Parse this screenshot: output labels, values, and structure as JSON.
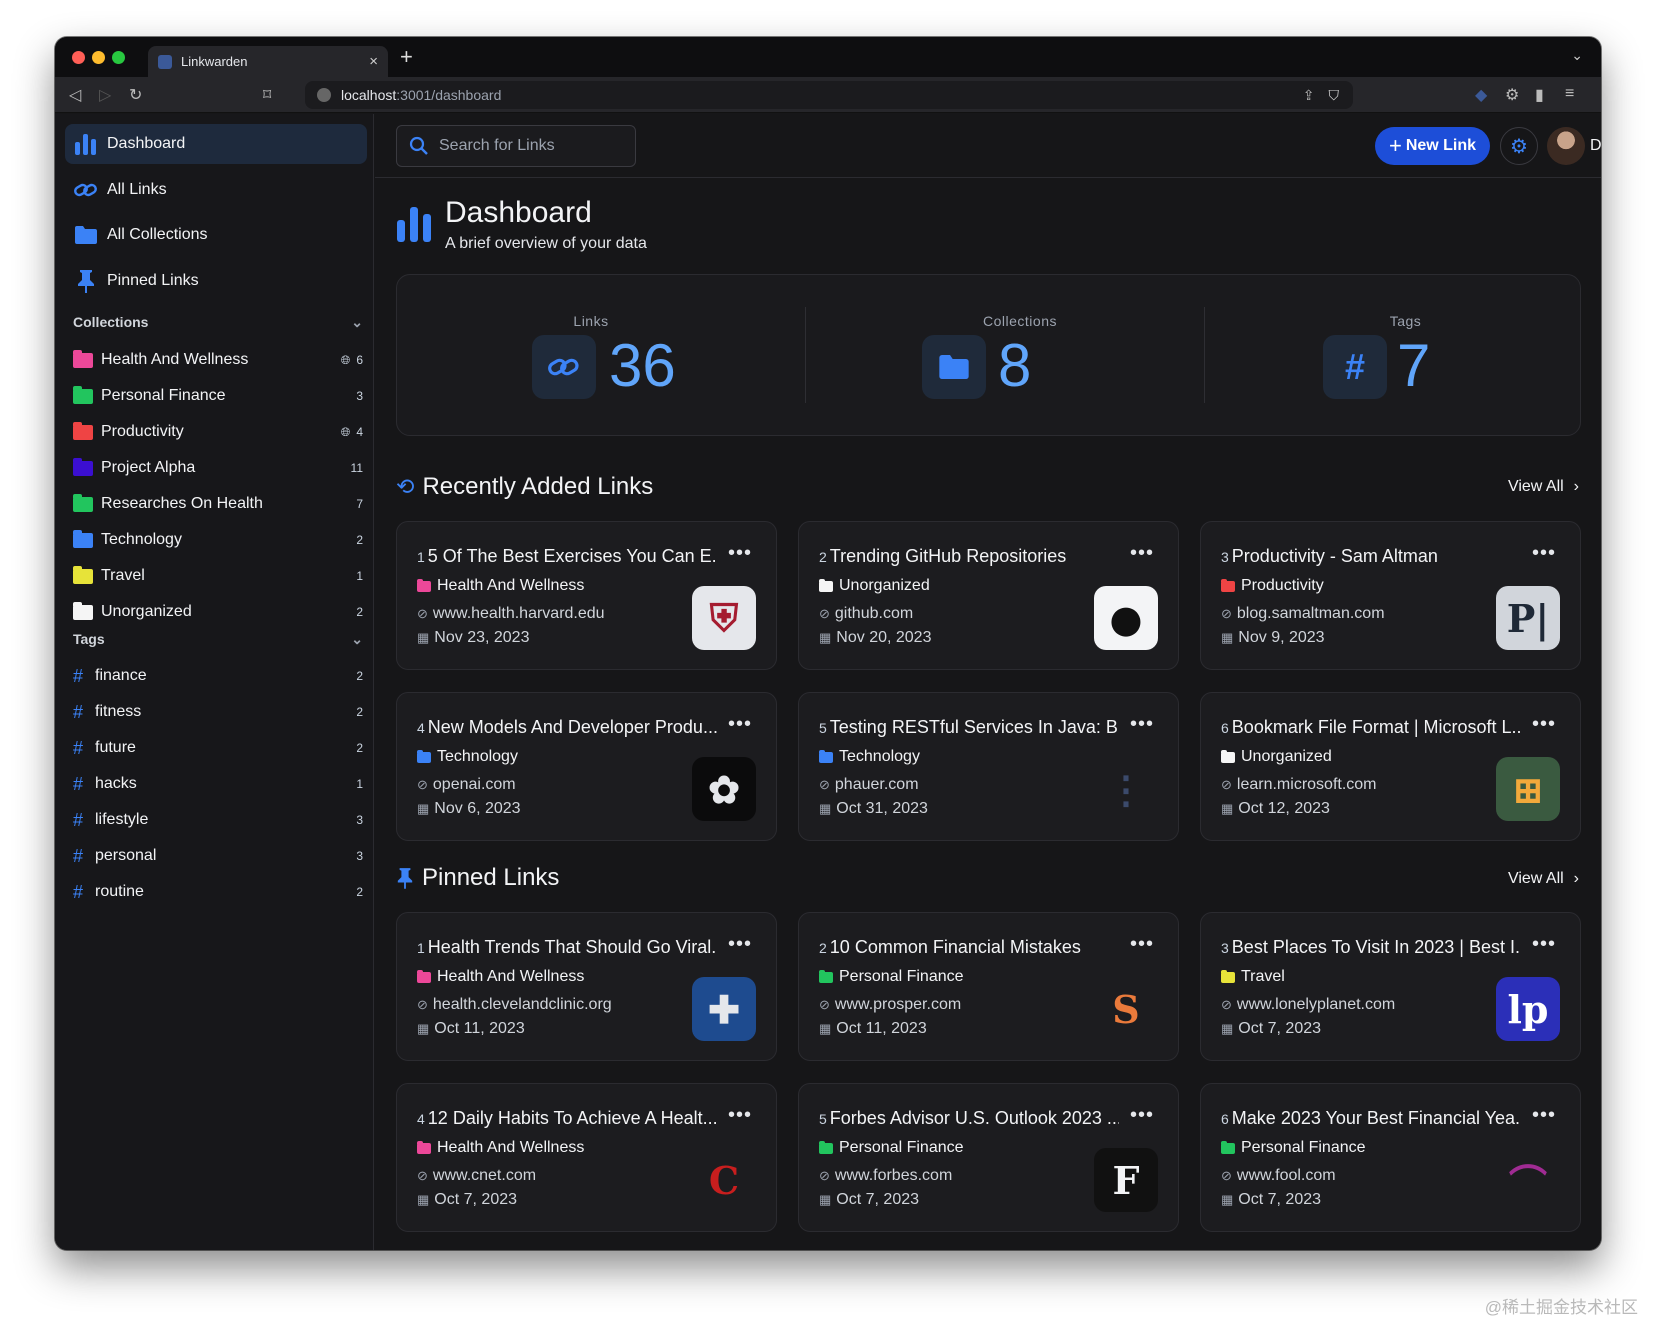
{
  "browser": {
    "tab_title": "Linkwarden",
    "tab_close": "×",
    "new_tab": "+",
    "url_host": "localhost",
    "url_path": ":3001/dashboard"
  },
  "sidebar": {
    "nav": [
      {
        "label": "Dashboard",
        "icon": "chart-bar-icon"
      },
      {
        "label": "All Links",
        "icon": "link-icon"
      },
      {
        "label": "All Collections",
        "icon": "folder-icon"
      },
      {
        "label": "Pinned Links",
        "icon": "thumbtack-icon"
      }
    ],
    "collections_title": "Collections",
    "collections": [
      {
        "name": "Health And Wellness",
        "count": "6",
        "public": true,
        "color": "#ec4899"
      },
      {
        "name": "Personal Finance",
        "count": "3",
        "public": false,
        "color": "#22c55e"
      },
      {
        "name": "Productivity",
        "count": "4",
        "public": true,
        "color": "#ef4444"
      },
      {
        "name": "Project Alpha",
        "count": "11",
        "public": false,
        "color": "#3b0fd1"
      },
      {
        "name": "Researches On Health",
        "count": "7",
        "public": false,
        "color": "#22c55e"
      },
      {
        "name": "Technology",
        "count": "2",
        "public": false,
        "color": "#3b82f6"
      },
      {
        "name": "Travel",
        "count": "1",
        "public": false,
        "color": "#e7e339"
      },
      {
        "name": "Unorganized",
        "count": "2",
        "public": false,
        "color": "#f5f5f5"
      }
    ],
    "tags_title": "Tags",
    "tags": [
      {
        "name": "finance",
        "count": "2"
      },
      {
        "name": "fitness",
        "count": "2"
      },
      {
        "name": "future",
        "count": "2"
      },
      {
        "name": "hacks",
        "count": "1"
      },
      {
        "name": "lifestyle",
        "count": "3"
      },
      {
        "name": "personal",
        "count": "3"
      },
      {
        "name": "routine",
        "count": "2"
      }
    ]
  },
  "topbar": {
    "search_placeholder": "Search for Links",
    "new_link": "New Link",
    "user_name": "Daniel"
  },
  "header": {
    "title": "Dashboard",
    "subtitle": "A brief overview of your data"
  },
  "stats": [
    {
      "label": "Links",
      "value": "36"
    },
    {
      "label": "Collections",
      "value": "8"
    },
    {
      "label": "Tags",
      "value": "7"
    }
  ],
  "recent": {
    "title": "Recently Added Links",
    "view_all": "View All",
    "cards": [
      {
        "num": "1",
        "title": "5 Of The Best Exercises You Can E...",
        "collection": "Health And Wellness",
        "color": "#ec4899",
        "domain": "www.health.harvard.edu",
        "date": "Nov 23, 2023",
        "thumb_bg": "#e5e7eb",
        "thumb_fg": "#a51c30",
        "thumb_text": "⛨"
      },
      {
        "num": "2",
        "title": "Trending GitHub Repositories",
        "collection": "Unorganized",
        "color": "#f5f5f5",
        "domain": "github.com",
        "date": "Nov 20, 2023",
        "thumb_bg": "#f3f4f6",
        "thumb_fg": "#111",
        "thumb_text": "●"
      },
      {
        "num": "3",
        "title": "Productivity - Sam Altman",
        "collection": "Productivity",
        "color": "#ef4444",
        "domain": "blog.samaltman.com",
        "date": "Nov 9, 2023",
        "thumb_bg": "#d1d5db",
        "thumb_fg": "#1f2937",
        "thumb_text": "P|"
      },
      {
        "num": "4",
        "title": "New Models And Developer Produ...",
        "collection": "Technology",
        "color": "#3b82f6",
        "domain": "openai.com",
        "date": "Nov 6, 2023",
        "thumb_bg": "#0b0b0c",
        "thumb_fg": "#e5e7eb",
        "thumb_text": "✿"
      },
      {
        "num": "5",
        "title": "Testing RESTful Services In Java: B...",
        "collection": "Technology",
        "color": "#3b82f6",
        "domain": "phauer.com",
        "date": "Oct 31, 2023",
        "thumb_bg": "transparent",
        "thumb_fg": "#3b4a6b",
        "thumb_text": "⋮"
      },
      {
        "num": "6",
        "title": "Bookmark File Format | Microsoft L...",
        "collection": "Unorganized",
        "color": "#f5f5f5",
        "domain": "learn.microsoft.com",
        "date": "Oct 12, 2023",
        "thumb_bg": "#3a5a40",
        "thumb_fg": "#f2a93b",
        "thumb_text": "⊞"
      }
    ]
  },
  "pinned": {
    "title": "Pinned Links",
    "view_all": "View All",
    "cards": [
      {
        "num": "1",
        "title": "Health Trends That Should Go Viral...",
        "collection": "Health And Wellness",
        "color": "#ec4899",
        "domain": "health.clevelandclinic.org",
        "date": "Oct 11, 2023",
        "thumb_bg": "#1e4b8f",
        "thumb_fg": "#e5e7eb",
        "thumb_text": "✚"
      },
      {
        "num": "2",
        "title": "10 Common Financial Mistakes",
        "collection": "Personal Finance",
        "color": "#22c55e",
        "domain": "www.prosper.com",
        "date": "Oct 11, 2023",
        "thumb_bg": "transparent",
        "thumb_fg": "#ea7a3b",
        "thumb_text": "S"
      },
      {
        "num": "3",
        "title": "Best Places To Visit In 2023 | Best I...",
        "collection": "Travel",
        "color": "#e7e339",
        "domain": "www.lonelyplanet.com",
        "date": "Oct 7, 2023",
        "thumb_bg": "#2b2fb8",
        "thumb_fg": "#ffffff",
        "thumb_text": "lp"
      },
      {
        "num": "4",
        "title": "12 Daily Habits To Achieve A Healt...",
        "collection": "Health And Wellness",
        "color": "#ec4899",
        "domain": "www.cnet.com",
        "date": "Oct 7, 2023",
        "thumb_bg": "transparent",
        "thumb_fg": "#c81e1e",
        "thumb_text": "C"
      },
      {
        "num": "5",
        "title": "Forbes Advisor U.S. Outlook 2023 ...",
        "collection": "Personal Finance",
        "color": "#22c55e",
        "domain": "www.forbes.com",
        "date": "Oct 7, 2023",
        "thumb_bg": "#111",
        "thumb_fg": "#f3f4f6",
        "thumb_text": "F"
      },
      {
        "num": "6",
        "title": "Make 2023 Your Best Financial Yea...",
        "collection": "Personal Finance",
        "color": "#22c55e",
        "domain": "www.fool.com",
        "date": "Oct 7, 2023",
        "thumb_bg": "transparent",
        "thumb_fg": "#a02b93",
        "thumb_text": "⌒"
      }
    ]
  },
  "watermark": "@稀土掘金技术社区"
}
